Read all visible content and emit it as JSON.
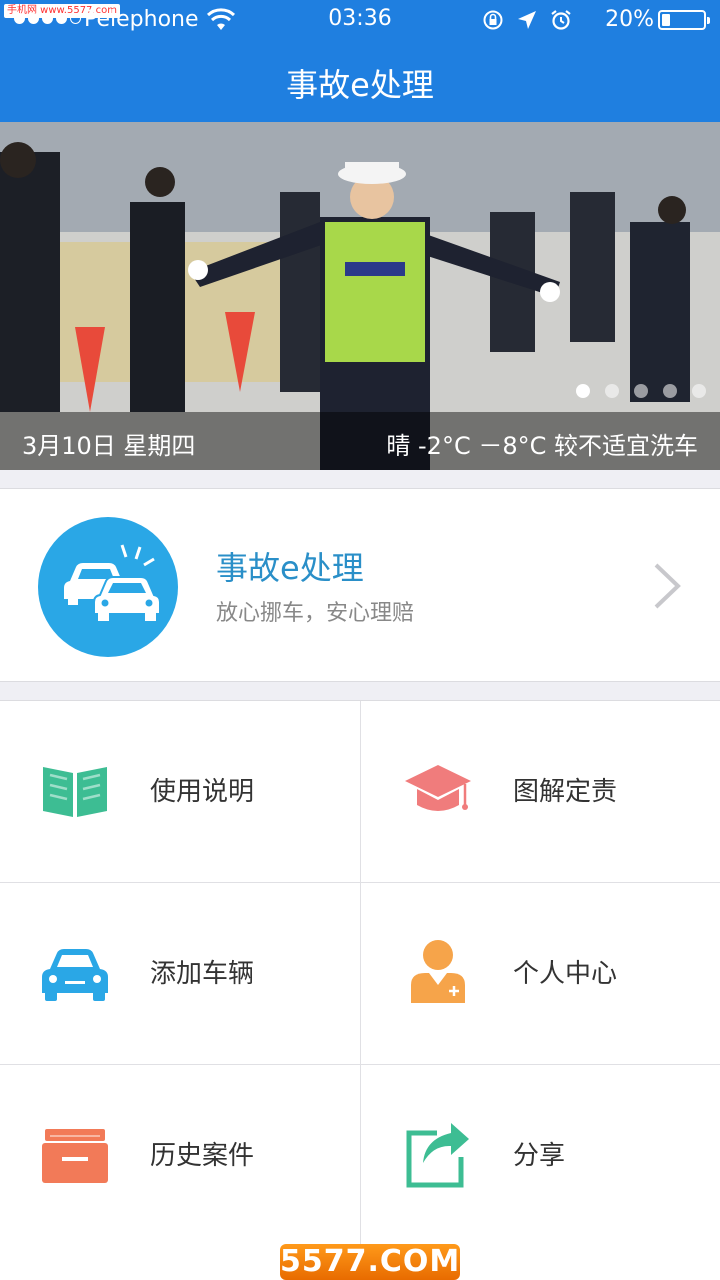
{
  "status_bar": {
    "watermark": "手机网 www.5577.com",
    "carrier": "Pelephone",
    "time": "03:36",
    "battery_percent": "20%",
    "battery_level": 0.2,
    "icons": [
      "signal-dots-icon",
      "wifi-icon",
      "rotation-lock-icon",
      "location-arrow-icon",
      "alarm-icon",
      "battery-icon"
    ]
  },
  "nav": {
    "title": "事故e处理"
  },
  "banner": {
    "date": "3月10日   星期四",
    "weather": "晴   -2°C －8°C   较不适宜洗车",
    "slide_count": 5,
    "active_slide": 1
  },
  "feature": {
    "title": "事故e处理",
    "subtitle": "放心挪车，安心理赔",
    "icon": "car-collision-icon",
    "color": "#2aa7e6"
  },
  "menu": [
    {
      "label": "使用说明",
      "icon": "open-book-icon",
      "color": "#3dbd93"
    },
    {
      "label": "图解定责",
      "icon": "graduation-cap-icon",
      "color": "#f07c7c"
    },
    {
      "label": "添加车辆",
      "icon": "car-icon",
      "color": "#2aa7e6"
    },
    {
      "label": "个人中心",
      "icon": "user-add-icon",
      "color": "#f6a44a"
    },
    {
      "label": "历史案件",
      "icon": "archive-box-icon",
      "color": "#f27a58"
    },
    {
      "label": "分享",
      "icon": "share-icon",
      "color": "#3dbd93"
    }
  ],
  "footer": {
    "watermark": "5577.COM"
  },
  "colors": {
    "primary": "#1f7fe0",
    "background": "#efeff4"
  }
}
